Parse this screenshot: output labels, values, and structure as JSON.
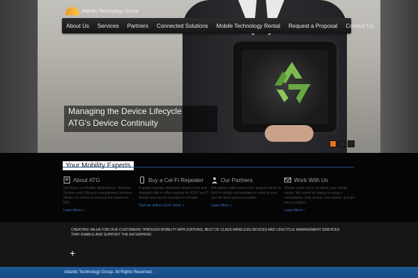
{
  "logo": {
    "text": "Atlantic Technology Group"
  },
  "nav": {
    "items": [
      "About Us",
      "Services",
      "Partners",
      "Connected Solutions",
      "Mobile Technology Rental",
      "Request a Proposal",
      "Contact Us"
    ]
  },
  "hero": {
    "caption_line1": "Managing the Device Lifecycle",
    "caption_line2": "ATG's Device Continuity"
  },
  "features": {
    "heading": "Your Mobility Experts",
    "columns": [
      {
        "title": "About ATG",
        "description": "Our focus on Mobility Applications, Wireless Devices and Lifecycle management services allows our clients to achieve the maximum ROI.",
        "link": "Learn More »"
      },
      {
        "title": "Buy a Cel-Fi Repeater",
        "description": "A smart repeater eliminates dead zones and dropped calls in office spaces for AT&T and T-Mobile and can be installed in minutes.",
        "link": "Visit our online Cel-Fi store! »"
      },
      {
        "title": "Our Partners",
        "description": "We partner with some of the largest names in field of mobile technologies in order to give you the best options possible.",
        "link": "Learn More »"
      },
      {
        "title": "Work With Us",
        "description": "Please reach out to us about your mobile needs. We would be happy to setup a consultation, help assess your needs, and get you a solution.",
        "link": "Learn More »"
      }
    ]
  },
  "tagline": {
    "text": "CREATING VALUE FOR OUR CUSTOMERS THROUGH MOBILITY APPLICATIONS, BEST OF CLASS WIRELESS DEVICES AND LIFECYCLE MANAGEMENT SERVICES THAT ENABLE AND SUPPORT THE ENTERPRISE",
    "plus": "+"
  },
  "footer": {
    "copyright": "Atlantic Technology Group. All Rights Reserved."
  },
  "colors": {
    "accent": "#e8731e",
    "link": "#3a77c9",
    "footer": "#1f5a98",
    "recycle": "#7dbb4f"
  },
  "icons": [
    "recycle-icon",
    "document-icon",
    "phone-icon",
    "partners-icon",
    "envelope-icon"
  ]
}
